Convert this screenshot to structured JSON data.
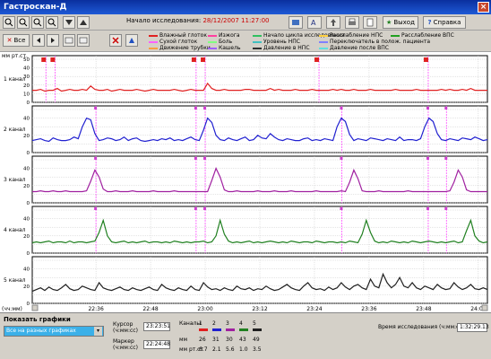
{
  "window": {
    "title": "Гастроскан-Д",
    "close_glyph": "×"
  },
  "toolbar": {
    "record_label": "Начало исследования:",
    "record_value": "28/12/2007 11:27:00",
    "exit_label": "Выход",
    "help_label": "Справка",
    "all_label": "Все"
  },
  "legend": [
    {
      "label": "Влажный глоток",
      "color": "#e02020"
    },
    {
      "label": "Сухой глоток",
      "color": "#ff60ff"
    },
    {
      "label": "Движение трубки",
      "color": "#ff9f40"
    },
    {
      "label": "Изжога",
      "color": "#ff40a0"
    },
    {
      "label": "Боль",
      "color": "#80ff80"
    },
    {
      "label": "Кашель",
      "color": "#a060ff"
    },
    {
      "label": "Начало цикла исследования",
      "color": "#30c060"
    },
    {
      "label": "Уровень НПС",
      "color": "#40c0c0"
    },
    {
      "label": "Давление в НПС",
      "color": "#303030"
    },
    {
      "label": "Расслабление НПС",
      "color": "#ffd040"
    },
    {
      "label": "Переключатель в полож. пациента",
      "color": "#8080ff"
    },
    {
      "label": "Давление после ВПС",
      "color": "#60e0e0"
    },
    {
      "label": "Расслабление ВПС",
      "color": "#20a020"
    }
  ],
  "chart_data": {
    "type": "line",
    "y_unit": "мм рт.ст.",
    "ylim": [
      0,
      50
    ],
    "y_ticks": [
      "0",
      "10",
      "20",
      "30",
      "40",
      "50"
    ],
    "x_ticks": [
      "22:36",
      "22:48",
      "23:00",
      "23:12",
      "23:24",
      "23:36",
      "23:48",
      "24:00"
    ],
    "x_axis_label": "(чч:мм)",
    "series": [
      {
        "name": "1 канал",
        "color": "#e02020",
        "values": [
          14,
          14,
          15,
          13,
          14,
          14,
          16,
          13,
          14,
          15,
          14,
          14,
          15,
          14,
          19,
          15,
          14,
          14,
          15,
          13,
          14,
          15,
          14,
          14,
          14,
          15,
          14,
          13,
          14,
          15,
          14,
          14,
          14,
          14,
          15,
          14,
          13,
          14,
          15,
          14,
          14,
          14,
          22,
          16,
          14,
          14,
          15,
          14,
          14,
          14,
          14,
          15,
          15,
          14,
          14,
          14,
          14,
          16,
          14,
          15,
          14,
          14,
          14,
          15,
          14,
          14,
          14,
          15,
          14,
          14,
          14,
          14,
          15,
          14,
          15,
          14,
          14,
          15,
          14,
          14,
          14,
          15,
          14,
          14,
          14,
          14,
          14,
          15,
          14,
          14,
          14,
          14,
          15,
          14,
          14,
          14,
          14,
          14,
          15,
          14,
          15,
          14,
          14,
          15,
          14,
          16,
          14,
          14,
          14,
          14
        ]
      },
      {
        "name": "2 канал",
        "color": "#2020d0",
        "values": [
          14,
          15,
          16,
          14,
          13,
          17,
          15,
          14,
          14,
          15,
          18,
          16,
          30,
          40,
          38,
          22,
          14,
          15,
          17,
          16,
          14,
          15,
          18,
          14,
          16,
          17,
          14,
          13,
          14,
          15,
          14,
          16,
          15,
          17,
          14,
          15,
          14,
          16,
          18,
          15,
          14,
          26,
          40,
          35,
          20,
          15,
          14,
          17,
          15,
          14,
          16,
          18,
          14,
          15,
          20,
          17,
          16,
          22,
          18,
          15,
          14,
          16,
          15,
          14,
          14,
          16,
          17,
          14,
          15,
          14,
          16,
          15,
          14,
          30,
          40,
          36,
          21,
          14,
          16,
          15,
          14,
          17,
          16,
          15,
          14,
          16,
          15,
          14,
          18,
          14,
          15,
          15,
          14,
          16,
          30,
          40,
          36,
          22,
          15,
          14,
          16,
          15,
          14,
          17,
          16,
          15,
          18,
          16,
          14,
          15
        ]
      },
      {
        "name": "3 канал",
        "color": "#a020a0",
        "values": [
          13,
          13,
          14,
          13,
          13,
          14,
          13,
          13,
          14,
          13,
          13,
          13,
          13,
          14,
          25,
          38,
          30,
          16,
          13,
          13,
          14,
          13,
          13,
          13,
          14,
          13,
          13,
          13,
          13,
          14,
          13,
          13,
          13,
          13,
          14,
          13,
          13,
          13,
          13,
          13,
          13,
          13,
          13,
          26,
          40,
          30,
          15,
          13,
          13,
          14,
          13,
          13,
          13,
          13,
          14,
          13,
          13,
          13,
          14,
          13,
          13,
          13,
          14,
          13,
          13,
          13,
          13,
          13,
          14,
          13,
          13,
          13,
          13,
          13,
          14,
          13,
          24,
          38,
          28,
          14,
          13,
          13,
          13,
          14,
          13,
          13,
          13,
          13,
          13,
          13,
          14,
          13,
          13,
          13,
          13,
          13,
          13,
          13,
          13,
          13,
          14,
          24,
          38,
          30,
          15,
          13,
          13,
          13,
          13,
          13
        ]
      },
      {
        "name": "4 канал",
        "color": "#208020",
        "values": [
          12,
          13,
          12,
          13,
          14,
          12,
          13,
          13,
          12,
          14,
          12,
          13,
          13,
          12,
          13,
          14,
          24,
          38,
          20,
          13,
          12,
          13,
          14,
          12,
          13,
          12,
          13,
          14,
          12,
          13,
          13,
          12,
          13,
          12,
          14,
          13,
          12,
          13,
          12,
          13,
          13,
          14,
          12,
          13,
          20,
          38,
          22,
          14,
          12,
          13,
          12,
          13,
          14,
          12,
          13,
          12,
          13,
          14,
          13,
          12,
          13,
          12,
          14,
          13,
          12,
          13,
          13,
          12,
          14,
          13,
          12,
          13,
          13,
          12,
          13,
          12,
          14,
          13,
          12,
          22,
          38,
          24,
          14,
          12,
          13,
          12,
          14,
          13,
          12,
          13,
          12,
          14,
          13,
          12,
          13,
          14,
          13,
          12,
          13,
          12,
          13,
          14,
          12,
          13,
          26,
          38,
          20,
          14,
          12,
          13
        ]
      },
      {
        "name": "5 канал",
        "color": "#202020",
        "values": [
          14,
          16,
          18,
          15,
          19,
          16,
          15,
          18,
          22,
          17,
          15,
          16,
          20,
          18,
          16,
          15,
          24,
          18,
          16,
          15,
          17,
          19,
          16,
          15,
          18,
          16,
          15,
          17,
          19,
          16,
          15,
          22,
          18,
          16,
          15,
          18,
          16,
          15,
          20,
          16,
          15,
          24,
          19,
          16,
          17,
          15,
          18,
          16,
          15,
          20,
          17,
          16,
          18,
          15,
          17,
          16,
          20,
          17,
          15,
          16,
          19,
          22,
          18,
          16,
          15,
          20,
          24,
          18,
          16,
          17,
          15,
          19,
          16,
          18,
          24,
          19,
          16,
          20,
          22,
          18,
          16,
          28,
          20,
          18,
          34,
          24,
          18,
          22,
          30,
          20,
          18,
          24,
          18,
          16,
          20,
          18,
          16,
          22,
          18,
          16,
          17,
          24,
          19,
          16,
          18,
          22,
          17,
          16,
          18,
          16
        ]
      }
    ],
    "markers": [
      {
        "time": "22:25",
        "channels": [
          1
        ]
      },
      {
        "time": "22:27",
        "channels": [
          1
        ]
      },
      {
        "time": "22:36",
        "channels": [
          2,
          3,
          4
        ]
      },
      {
        "time": "22:58",
        "channels": [
          1,
          2,
          3,
          4
        ]
      },
      {
        "time": "23:00",
        "channels": [
          1,
          2,
          3,
          4
        ]
      },
      {
        "time": "23:25",
        "channels": [
          1
        ]
      },
      {
        "time": "23:30",
        "channels": [
          2,
          3,
          4
        ]
      },
      {
        "time": "23:49",
        "channels": [
          1,
          2,
          3,
          4
        ]
      },
      {
        "time": "23:53",
        "channels": [
          2,
          3,
          4
        ]
      }
    ]
  },
  "bottom": {
    "show_graphs_label": "Показать графики",
    "show_graphs_value": "Все на разных графиках",
    "cursor_label": "Курсор (ч:мм:сс)",
    "cursor_value": "23:23:51",
    "marker_label": "Маркер (ч:мм:сс)",
    "marker_value": "22:24:48",
    "channels_label": "Каналы",
    "channel_numbers": [
      "1",
      "2",
      "3",
      "4",
      "5"
    ],
    "row1_label": "мм",
    "row1_values": [
      "26",
      "31",
      "30",
      "43",
      "49"
    ],
    "row2_label": "мм рт.ст",
    "row2_values": [
      "6.7",
      "2.1",
      "5.6",
      "1.0",
      "3.5"
    ],
    "time_label": "Время исследования (ч:мм:сс)",
    "time_value": "1:32:29.13"
  }
}
